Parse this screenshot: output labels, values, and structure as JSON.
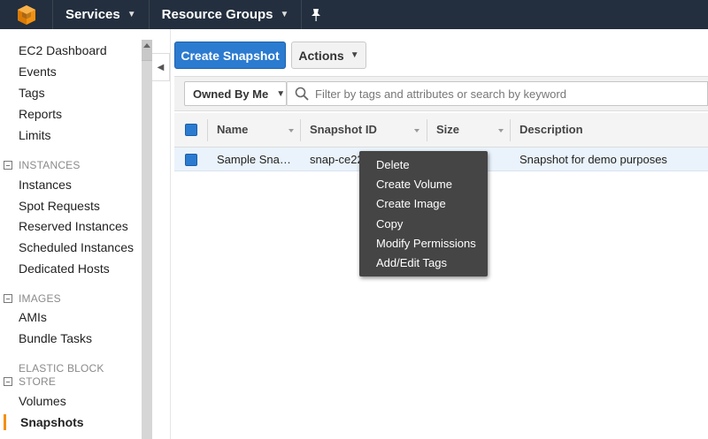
{
  "topnav": {
    "logo_icon": "aws-cube-icon",
    "services_label": "Services",
    "resource_groups_label": "Resource Groups",
    "pin_icon": "pin-icon"
  },
  "sidebar": {
    "items_top": [
      "EC2 Dashboard",
      "Events",
      "Tags",
      "Reports",
      "Limits"
    ],
    "sections": [
      {
        "title": "INSTANCES",
        "items": [
          "Instances",
          "Spot Requests",
          "Reserved Instances",
          "Scheduled Instances",
          "Dedicated Hosts"
        ]
      },
      {
        "title": "IMAGES",
        "items": [
          "AMIs",
          "Bundle Tasks"
        ]
      },
      {
        "title_line1": "ELASTIC BLOCK",
        "title_line2": "STORE",
        "items": [
          "Volumes",
          "Snapshots"
        ]
      }
    ],
    "active_item": "Snapshots",
    "accent_color": "#f29111"
  },
  "toolbar": {
    "create_label": "Create Snapshot",
    "actions_label": "Actions"
  },
  "filter": {
    "owner_selected": "Owned By Me",
    "search_placeholder": "Filter by tags and attributes or search by keyword"
  },
  "table": {
    "columns": [
      "Name",
      "Snapshot ID",
      "Size",
      "Description"
    ],
    "rows": [
      {
        "name": "Sample Sna…",
        "snapshot_id": "snap-ce22",
        "size": "",
        "description": "Snapshot for demo purposes"
      }
    ]
  },
  "context_menu": {
    "items": [
      "Delete",
      "Create Volume",
      "Create Image",
      "Copy",
      "Modify Permissions",
      "Add/Edit Tags"
    ]
  },
  "colors": {
    "nav_bg": "#232f3e",
    "primary_button": "#2b7bd0",
    "menu_bg": "#454545",
    "selected_row": "#eaf3fb"
  }
}
